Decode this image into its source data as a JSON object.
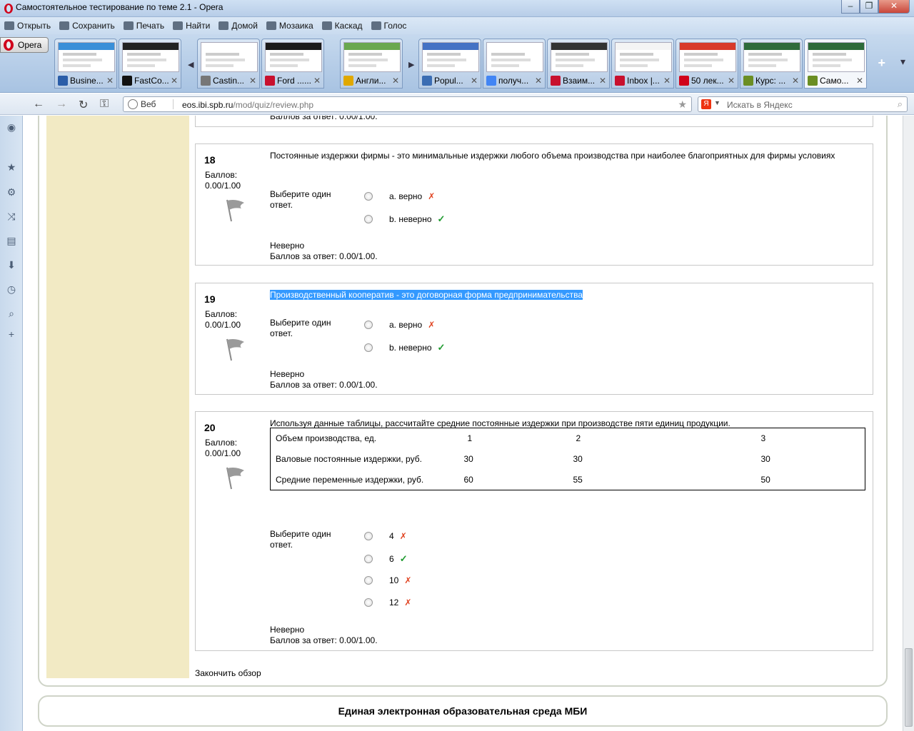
{
  "window": {
    "title": "Самостоятельное тестирование по теме 2.1 - Opera",
    "minimize": "–",
    "restore": "❐",
    "close": "✕"
  },
  "menubar": {
    "items": [
      "Открыть",
      "Сохранить",
      "Печать",
      "Найти",
      "Домой",
      "Мозаика",
      "Каскад",
      "Голос"
    ]
  },
  "tabbar": {
    "opera_label": "Opera",
    "tabs": [
      {
        "label": "Busine...",
        "fav_color": "#2a5da8",
        "thumb_color": "#3a8fd8"
      },
      {
        "label": "FastCo...",
        "fav_color": "#111111",
        "thumb_color": "#222222"
      },
      {
        "label": "Castin...",
        "fav_color": "#777777",
        "thumb_color": "#ffffff"
      },
      {
        "label": "Ford ......",
        "fav_color": "#c8102e",
        "thumb_color": "#1a1a1a"
      },
      {
        "label": "Англи...",
        "fav_color": "#e0a800",
        "thumb_color": "#6aa84f"
      },
      {
        "label": "Popul...",
        "fav_color": "#3b6db3",
        "thumb_color": "#4472c4"
      },
      {
        "label": "получ...",
        "fav_color": "#4285f4",
        "thumb_color": "#ffffff"
      },
      {
        "label": "Взаим...",
        "fav_color": "#c8102e",
        "thumb_color": "#333333"
      },
      {
        "label": "Inbox |...",
        "fav_color": "#c8102e",
        "thumb_color": "#f4f4f4"
      },
      {
        "label": "50 лек...",
        "fav_color": "#d0021b",
        "thumb_color": "#d83a2a"
      },
      {
        "label": "Курс: ...",
        "fav_color": "#6b8e23",
        "thumb_color": "#2e6b3a"
      },
      {
        "label": "Само...",
        "fav_color": "#6b8e23",
        "thumb_color": "#2e6b3a"
      }
    ],
    "new_tab": "+",
    "menu": "▾"
  },
  "addressbar": {
    "web_label": "Веб",
    "url_host": "eos.ibi.spb.ru",
    "url_path": "/mod/quiz/review.php",
    "search_placeholder": "Искать в Яндекс",
    "search_engine_badge": "Я"
  },
  "sidepanel": {
    "icons": [
      "opera-unite-icon",
      "bookmarks-icon",
      "settings-icon",
      "unite-icon",
      "notes-icon",
      "downloads-icon",
      "history-icon",
      "search-icon",
      "add-panel-icon"
    ]
  },
  "quiz": {
    "prev_tail": "Баллов за ответ: 0.00/1.00.",
    "questions": [
      {
        "number": "18",
        "score_label": "Баллов:",
        "score": "0.00/1.00",
        "text": "Постоянные издержки фирмы - это минимальные издержки любого объема производства при наиболее благоприятных для фирмы условиях",
        "choose": "Выберите один ответ.",
        "options": [
          {
            "label": "a. верно",
            "mark": "✗"
          },
          {
            "label": "b. неверно",
            "mark": "✓"
          }
        ],
        "result": "Неверно",
        "points": "Баллов за ответ: 0.00/1.00."
      },
      {
        "number": "19",
        "score_label": "Баллов:",
        "score": "0.00/1.00",
        "text": "Производственный кооператив - это договорная форма предпринимательства",
        "choose": "Выберите один ответ.",
        "options": [
          {
            "label": "a. верно",
            "mark": "✗"
          },
          {
            "label": "b. неверно",
            "mark": "✓"
          }
        ],
        "result": "Неверно",
        "points": "Баллов за ответ: 0.00/1.00."
      },
      {
        "number": "20",
        "score_label": "Баллов:",
        "score": "0.00/1.00",
        "text": "Используя данные таблицы, рассчитайте средние постоянные издержки при производстве пяти единиц продукции.",
        "table": [
          [
            "Объем производства, ед.",
            "1",
            "2",
            "3"
          ],
          [
            "Валовые постоянные издержки, руб.",
            "30",
            "30",
            "30"
          ],
          [
            "Средние переменные издержки, руб.",
            "60",
            "55",
            "50"
          ]
        ],
        "choose": "Выберите один ответ.",
        "options": [
          {
            "label": "4",
            "mark": "✗"
          },
          {
            "label": "6",
            "mark": "✓"
          },
          {
            "label": "10",
            "mark": "✗"
          },
          {
            "label": "12",
            "mark": "✗"
          }
        ],
        "result": "Неверно",
        "points": "Баллов за ответ: 0.00/1.00."
      }
    ],
    "finish_link": "Закончить обзор",
    "footer": "Единая электронная образовательная среда МБИ"
  },
  "colors": {
    "left_column": "#f2eac4",
    "highlight": "#3399ff",
    "mark_wrong": "#e0411e",
    "mark_right": "#1e9a2e"
  }
}
